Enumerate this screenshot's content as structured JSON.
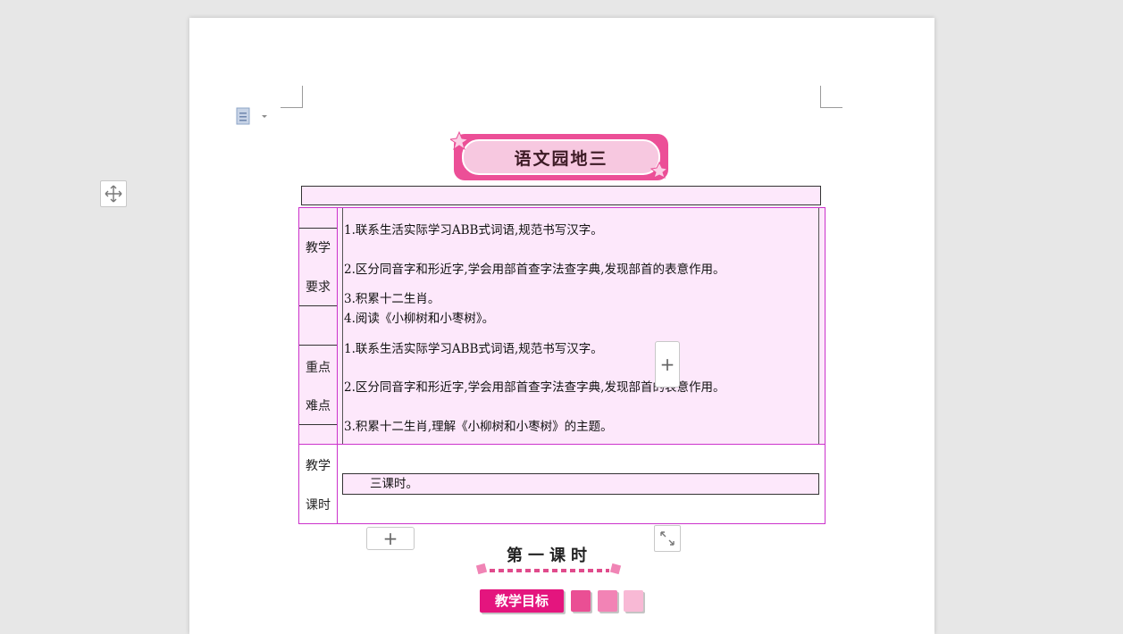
{
  "header": {
    "title": "语文园地三"
  },
  "table": {
    "row1": {
      "label_top": "教学",
      "label_bottom": "要求",
      "lines": [
        "1.联系生活实际学习ABB式词语,规范书写汉字。",
        "2.区分同音字和形近字,学会用部首查字法查字典,发现部首的表意作用。",
        "3.积累十二生肖。",
        "4.阅读《小柳树和小枣树》。"
      ]
    },
    "row2": {
      "label_top": "重点",
      "label_bottom": "难点",
      "lines": [
        "1.联系生活实际学习ABB式词语,规范书写汉字。",
        "2.区分同音字和形近字,学会用部首查字法查字典,发现部首的表意作用。",
        "3.积累十二生肖,理解《小柳树和小枣树》的主题。"
      ]
    },
    "row3": {
      "label_top": "教学",
      "label_bottom": "课时",
      "value": "三课时。"
    }
  },
  "controls": {
    "add_row_symbol": "+",
    "add_col_symbol": "+"
  },
  "section": {
    "lesson_title": "第一课时",
    "goal_tag": "教学目标"
  },
  "colors": {
    "accent_pink": "#e4157e",
    "cell_bg": "#fde8fb",
    "border_magenta": "#cc33cc"
  }
}
